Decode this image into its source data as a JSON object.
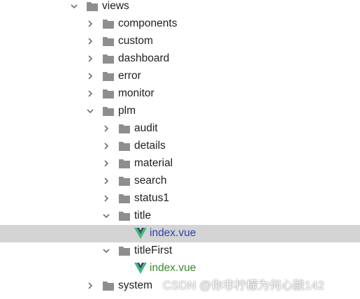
{
  "colors": {
    "folder": "#8e8e8e",
    "chevron": "#6e6e6e",
    "selected_bg": "#d4d4d4",
    "vue_outer": "#41b883",
    "vue_inner": "#34495e",
    "file_selected_text": "#2f43a6",
    "file_text": "#3a8a2a"
  },
  "tree": {
    "views": {
      "label": "views",
      "state": "expanded",
      "icon": "folder-icon"
    },
    "components": {
      "label": "components",
      "state": "collapsed",
      "icon": "folder-icon"
    },
    "custom": {
      "label": "custom",
      "state": "collapsed",
      "icon": "folder-icon"
    },
    "dashboard": {
      "label": "dashboard",
      "state": "collapsed",
      "icon": "folder-icon"
    },
    "error": {
      "label": "error",
      "state": "collapsed",
      "icon": "folder-icon"
    },
    "monitor": {
      "label": "monitor",
      "state": "collapsed",
      "icon": "folder-icon"
    },
    "plm": {
      "label": "plm",
      "state": "expanded",
      "icon": "folder-icon"
    },
    "audit": {
      "label": "audit",
      "state": "collapsed",
      "icon": "folder-icon"
    },
    "details": {
      "label": "details",
      "state": "collapsed",
      "icon": "folder-icon"
    },
    "material": {
      "label": "material",
      "state": "collapsed",
      "icon": "folder-icon"
    },
    "search": {
      "label": "search",
      "state": "collapsed",
      "icon": "folder-icon"
    },
    "status1": {
      "label": "status1",
      "state": "collapsed",
      "icon": "folder-icon"
    },
    "title": {
      "label": "title",
      "state": "expanded",
      "icon": "folder-icon"
    },
    "title_index": {
      "label": "index.vue",
      "selected": true,
      "icon": "vue-file-icon"
    },
    "titleFirst": {
      "label": "titleFirst",
      "state": "expanded",
      "icon": "folder-icon"
    },
    "titleFirst_index": {
      "label": "index.vue",
      "selected": false,
      "icon": "vue-file-icon"
    },
    "system": {
      "label": "system",
      "state": "collapsed",
      "icon": "folder-icon"
    }
  },
  "watermark": "CSDN @你非柠檬为何心酸142"
}
